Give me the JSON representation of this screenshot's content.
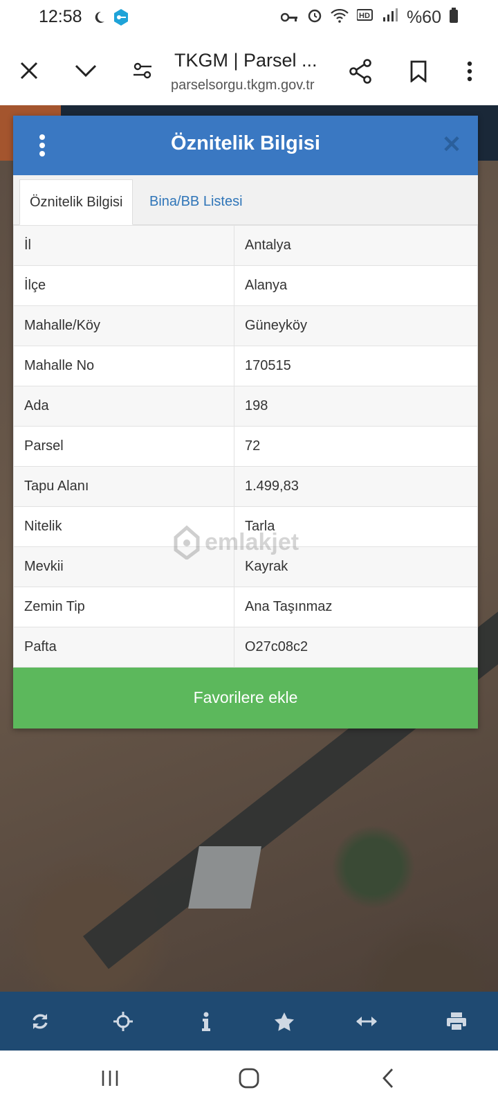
{
  "status": {
    "time": "12:58",
    "battery": "%60"
  },
  "browser": {
    "tab_title": "TKGM | Parsel ...",
    "url": "parselsorgu.tkgm.gov.tr"
  },
  "panel": {
    "title": "Öznitelik Bilgisi",
    "tabs": [
      {
        "label": "Öznitelik Bilgisi",
        "active": true
      },
      {
        "label": "Bina/BB Listesi",
        "active": false
      }
    ],
    "rows": [
      {
        "key": "İl",
        "value": "Antalya"
      },
      {
        "key": "İlçe",
        "value": "Alanya"
      },
      {
        "key": "Mahalle/Köy",
        "value": "Güneyköy"
      },
      {
        "key": "Mahalle No",
        "value": "170515"
      },
      {
        "key": "Ada",
        "value": "198"
      },
      {
        "key": "Parsel",
        "value": "72"
      },
      {
        "key": "Tapu Alanı",
        "value": "1.499,83"
      },
      {
        "key": "Nitelik",
        "value": "Tarla"
      },
      {
        "key": "Mevkii",
        "value": "Kayrak"
      },
      {
        "key": "Zemin Tip",
        "value": "Ana Taşınmaz"
      },
      {
        "key": "Pafta",
        "value": "O27c08c2"
      }
    ],
    "fav_button": "Favorilere ekle"
  },
  "watermark": "emlakjet",
  "colors": {
    "header": "#3a78c2",
    "fav_button": "#5cb85c",
    "toolbar": "#1f4a72",
    "tab_link": "#2f75b8"
  },
  "toolbar_icons": [
    "refresh-icon",
    "locate-icon",
    "info-icon",
    "star-icon",
    "measure-icon",
    "print-icon"
  ]
}
